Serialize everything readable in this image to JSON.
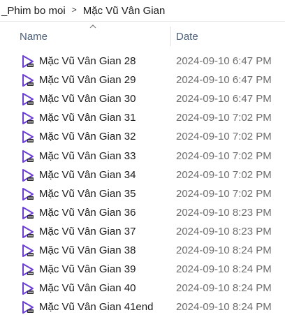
{
  "breadcrumb": {
    "items": [
      "_Phim bo moi",
      "Mặc Vũ Vân Gian"
    ],
    "separator": ">"
  },
  "columns": {
    "name": "Name",
    "date": "Date",
    "sort_icon": "sort-ascending-caret-icon"
  },
  "file_icon": "video-file-icon",
  "colors": {
    "icon_purple": "#6b3fd4",
    "header_text": "#4c607a",
    "date_text": "#6d6d6d"
  },
  "files": [
    {
      "name": "Mặc Vũ Vân Gian 28",
      "date": "2024-09-10 6:47 PM"
    },
    {
      "name": "Mặc Vũ Vân Gian 29",
      "date": "2024-09-10 6:47 PM"
    },
    {
      "name": "Mặc Vũ Vân Gian 30",
      "date": "2024-09-10 6:47 PM"
    },
    {
      "name": "Mặc Vũ Vân Gian 31",
      "date": "2024-09-10 7:02 PM"
    },
    {
      "name": "Mặc Vũ Vân Gian 32",
      "date": "2024-09-10 7:02 PM"
    },
    {
      "name": "Mặc Vũ Vân Gian 33",
      "date": "2024-09-10 7:02 PM"
    },
    {
      "name": "Mặc Vũ Vân Gian 34",
      "date": "2024-09-10 7:02 PM"
    },
    {
      "name": "Mặc Vũ Vân Gian 35",
      "date": "2024-09-10 7:02 PM"
    },
    {
      "name": "Mặc Vũ Vân Gian 36",
      "date": "2024-09-10 8:23 PM"
    },
    {
      "name": "Mặc Vũ Vân Gian 37",
      "date": "2024-09-10 8:23 PM"
    },
    {
      "name": "Mặc Vũ Vân Gian 38",
      "date": "2024-09-10 8:24 PM"
    },
    {
      "name": "Mặc Vũ Vân Gian 39",
      "date": "2024-09-10 8:24 PM"
    },
    {
      "name": "Mặc Vũ Vân Gian 40",
      "date": "2024-09-10 8:24 PM"
    },
    {
      "name": "Mặc Vũ Vân Gian 41end",
      "date": "2024-09-10 8:24 PM"
    }
  ]
}
